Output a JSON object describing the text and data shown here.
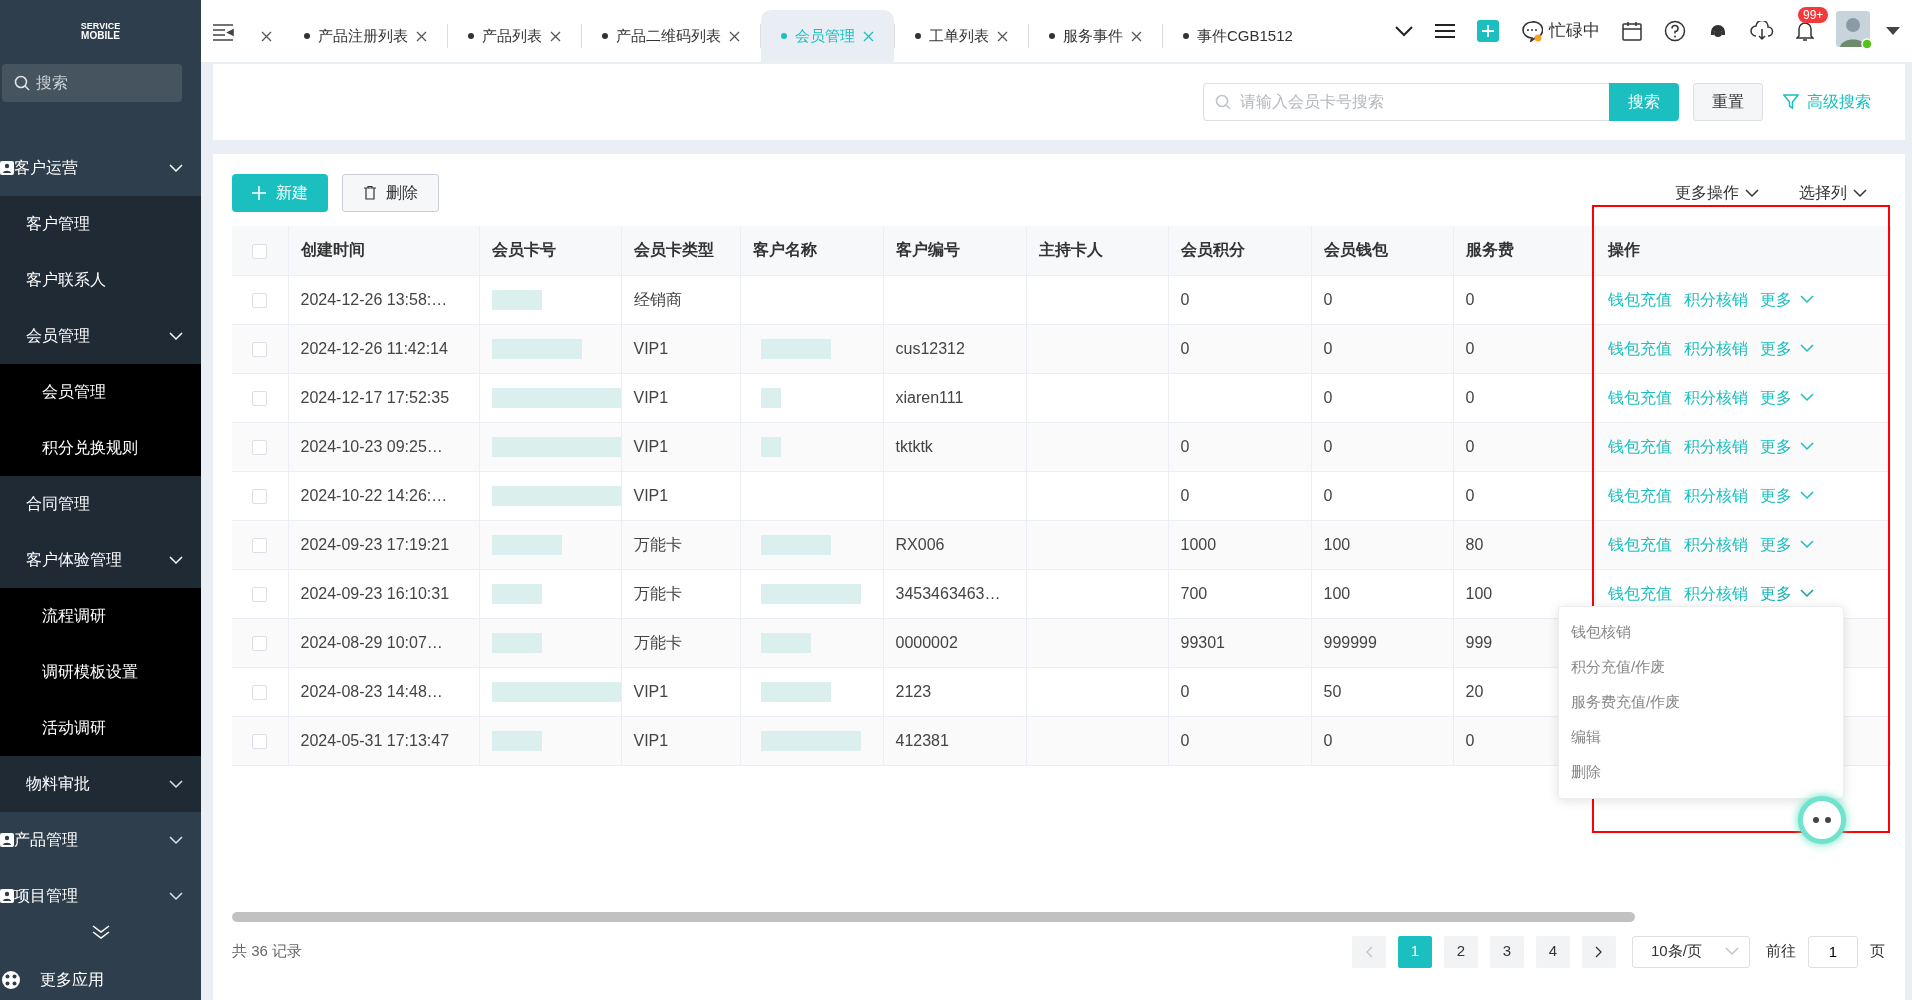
{
  "logo": {
    "small": "SERVICE",
    "big": "MOBILE"
  },
  "sidebar": {
    "search_placeholder": "搜索",
    "items": [
      {
        "label": "客户运营",
        "expanded": true,
        "children": [
          {
            "label": "客户管理"
          },
          {
            "label": "客户联系人"
          },
          {
            "label": "会员管理",
            "expanded": true,
            "children": [
              {
                "label": "会员管理"
              },
              {
                "label": "积分兑换规则"
              }
            ]
          },
          {
            "label": "合同管理"
          },
          {
            "label": "客户体验管理",
            "expanded": true,
            "children": [
              {
                "label": "流程调研"
              },
              {
                "label": "调研模板设置"
              },
              {
                "label": "活动调研"
              }
            ]
          },
          {
            "label": "物料审批",
            "expanded": false
          }
        ]
      },
      {
        "label": "产品管理",
        "expanded": false
      },
      {
        "label": "项目管理",
        "expanded": false
      }
    ],
    "more_apps": "更多应用"
  },
  "tabs": [
    {
      "selected": false
    },
    {
      "label": "产品注册列表",
      "selected": false
    },
    {
      "label": "产品列表",
      "selected": false
    },
    {
      "label": "产品二维码列表",
      "selected": false
    },
    {
      "label": "会员管理",
      "selected": true
    },
    {
      "label": "工单列表",
      "selected": false
    },
    {
      "label": "服务事件",
      "selected": false
    },
    {
      "label": "事件CGB1512",
      "selected": false
    }
  ],
  "header": {
    "status": "忙碌中",
    "notifications": "99+"
  },
  "search": {
    "placeholder": "请输入会员卡号搜索",
    "button": "搜索",
    "reset": "重置",
    "advanced": "高级搜索"
  },
  "toolbar": {
    "new": "新建",
    "delete": "删除",
    "more_actions": "更多操作",
    "choose_columns": "选择列"
  },
  "table": {
    "columns": [
      "创建时间",
      "会员卡号",
      "会员卡类型",
      "客户名称",
      "客户编号",
      "主持卡人",
      "会员积分",
      "会员钱包",
      "服务费",
      "操作"
    ],
    "header_checked": false,
    "rows": [
      {
        "checked": false,
        "cells": [
          "2024-12-26 13:58:…",
          "",
          "经销商",
          "",
          "",
          "",
          "0",
          "0",
          "0"
        ],
        "actions": [
          "钱包充值",
          "积分核销",
          "更多"
        ],
        "menu_open": false
      },
      {
        "checked": false,
        "cells": [
          "2024-12-26 11:42:14",
          "",
          "VIP1",
          "",
          "cus12312",
          "",
          "0",
          "0",
          "0"
        ],
        "actions": [
          "钱包充值",
          "积分核销",
          "更多"
        ],
        "menu_open": false
      },
      {
        "checked": false,
        "cells": [
          "2024-12-17 17:52:35",
          "",
          "VIP1",
          "",
          "xiaren111",
          "",
          "",
          "0",
          "0"
        ],
        "actions": [
          "钱包充值",
          "积分核销",
          "更多"
        ],
        "menu_open": false
      },
      {
        "checked": false,
        "cells": [
          "2024-10-23 09:25…",
          "",
          "VIP1",
          "",
          "tktktk",
          "",
          "0",
          "0",
          "0"
        ],
        "actions": [
          "钱包充值",
          "积分核销",
          "更多"
        ],
        "menu_open": false
      },
      {
        "checked": false,
        "cells": [
          "2024-10-22 14:26:…",
          "",
          "VIP1",
          "",
          "",
          "",
          "0",
          "0",
          "0"
        ],
        "actions": [
          "钱包充值",
          "积分核销",
          "更多"
        ],
        "menu_open": false
      },
      {
        "checked": false,
        "cells": [
          "2024-09-23 17:19:21",
          "",
          "万能卡",
          "",
          "RX006",
          "",
          "1000",
          "100",
          "80"
        ],
        "actions": [
          "钱包充值",
          "积分核销",
          "更多"
        ],
        "menu_open": false
      },
      {
        "checked": false,
        "cells": [
          "2024-09-23 16:10:31",
          "",
          "万能卡",
          "",
          "3453463463…",
          "",
          "700",
          "100",
          "100"
        ],
        "actions": [
          "钱包充值",
          "积分核销",
          "更多"
        ],
        "menu_open": true
      },
      {
        "checked": false,
        "cells": [
          "2024-08-29 10:07…",
          "",
          "万能卡",
          "",
          "0000002",
          "",
          "99301",
          "999999",
          "999"
        ]
      },
      {
        "checked": false,
        "cells": [
          "2024-08-23 14:48…",
          "",
          "VIP1",
          "",
          "2123",
          "",
          "0",
          "50",
          "20"
        ]
      },
      {
        "checked": false,
        "cells": [
          "2024-05-31 17:13:47",
          "",
          "VIP1",
          "",
          "412381",
          "",
          "0",
          "0",
          "0"
        ]
      }
    ]
  },
  "more_menu": [
    "钱包核销",
    "积分充值/作废",
    "服务费充值/作废",
    "编辑",
    "删除"
  ],
  "pagination": {
    "total": "共 36 记录",
    "pages": [
      {
        "label": "1",
        "selected": true
      },
      {
        "label": "2",
        "selected": false
      },
      {
        "label": "3",
        "selected": false
      },
      {
        "label": "4",
        "selected": false
      }
    ],
    "prev_disabled": true,
    "page_size": "10条/页",
    "goto_label": "前往",
    "goto_value": "1",
    "page_unit": "页"
  }
}
